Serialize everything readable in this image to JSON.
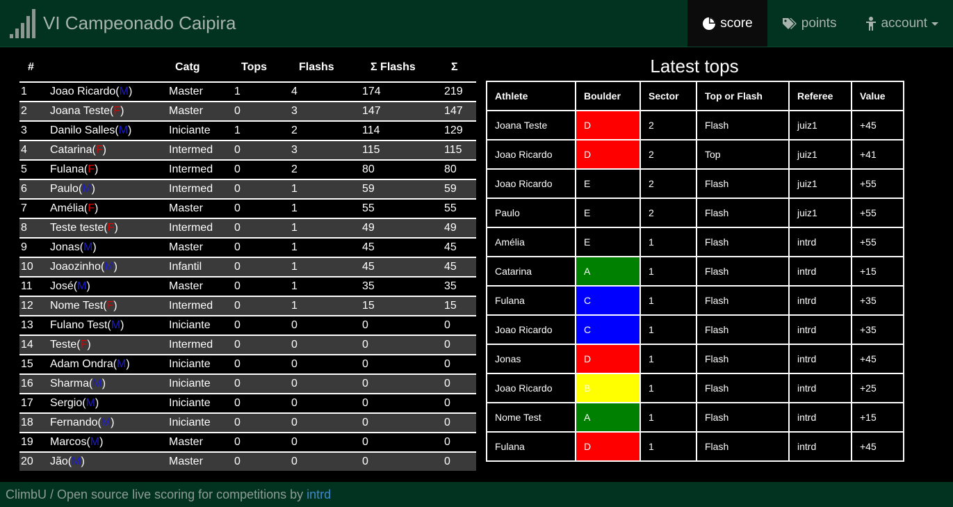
{
  "app": {
    "title": "VI Campeonado Caipira"
  },
  "nav": [
    {
      "label": "score",
      "icon": "pie-chart-icon",
      "active": true
    },
    {
      "label": "points",
      "icon": "tags-icon",
      "active": false
    },
    {
      "label": "account",
      "icon": "person-icon",
      "active": false,
      "dropdown": true
    }
  ],
  "scoreboard": {
    "headers": [
      "#",
      "",
      "Catg",
      "Tops",
      "Flashs",
      "Σ Flashs",
      "Σ"
    ],
    "rows": [
      {
        "rank": "1",
        "name": "Joao Ricardo",
        "gender": "M",
        "catg": "Master",
        "tops": "1",
        "flashs": "4",
        "sum_flashs": "174",
        "total": "219"
      },
      {
        "rank": "2",
        "name": "Joana Teste",
        "gender": "F",
        "catg": "Master",
        "tops": "0",
        "flashs": "3",
        "sum_flashs": "147",
        "total": "147"
      },
      {
        "rank": "3",
        "name": "Danilo Salles",
        "gender": "M",
        "catg": "Iniciante",
        "tops": "1",
        "flashs": "2",
        "sum_flashs": "114",
        "total": "129"
      },
      {
        "rank": "4",
        "name": "Catarina",
        "gender": "F",
        "catg": "Intermed",
        "tops": "0",
        "flashs": "3",
        "sum_flashs": "115",
        "total": "115"
      },
      {
        "rank": "5",
        "name": "Fulana",
        "gender": "F",
        "catg": "Intermed",
        "tops": "0",
        "flashs": "2",
        "sum_flashs": "80",
        "total": "80"
      },
      {
        "rank": "6",
        "name": "Paulo",
        "gender": "M",
        "catg": "Intermed",
        "tops": "0",
        "flashs": "1",
        "sum_flashs": "59",
        "total": "59"
      },
      {
        "rank": "7",
        "name": "Amélia",
        "gender": "F",
        "catg": "Master",
        "tops": "0",
        "flashs": "1",
        "sum_flashs": "55",
        "total": "55"
      },
      {
        "rank": "8",
        "name": "Teste teste",
        "gender": "F",
        "catg": "Intermed",
        "tops": "0",
        "flashs": "1",
        "sum_flashs": "49",
        "total": "49"
      },
      {
        "rank": "9",
        "name": "Jonas",
        "gender": "M",
        "catg": "Master",
        "tops": "0",
        "flashs": "1",
        "sum_flashs": "45",
        "total": "45"
      },
      {
        "rank": "10",
        "name": "Joaozinho",
        "gender": "M",
        "catg": "Infantil",
        "tops": "0",
        "flashs": "1",
        "sum_flashs": "45",
        "total": "45"
      },
      {
        "rank": "11",
        "name": "José",
        "gender": "M",
        "catg": "Master",
        "tops": "0",
        "flashs": "1",
        "sum_flashs": "35",
        "total": "35"
      },
      {
        "rank": "12",
        "name": "Nome Test",
        "gender": "F",
        "catg": "Intermed",
        "tops": "0",
        "flashs": "1",
        "sum_flashs": "15",
        "total": "15"
      },
      {
        "rank": "13",
        "name": "Fulano Test",
        "gender": "M",
        "catg": "Iniciante",
        "tops": "0",
        "flashs": "0",
        "sum_flashs": "0",
        "total": "0"
      },
      {
        "rank": "14",
        "name": "Teste",
        "gender": "F",
        "catg": "Intermed",
        "tops": "0",
        "flashs": "0",
        "sum_flashs": "0",
        "total": "0"
      },
      {
        "rank": "15",
        "name": "Adam Ondra",
        "gender": "M",
        "catg": "Iniciante",
        "tops": "0",
        "flashs": "0",
        "sum_flashs": "0",
        "total": "0"
      },
      {
        "rank": "16",
        "name": "Sharma",
        "gender": "M",
        "catg": "Iniciante",
        "tops": "0",
        "flashs": "0",
        "sum_flashs": "0",
        "total": "0"
      },
      {
        "rank": "17",
        "name": "Sergio",
        "gender": "M",
        "catg": "Iniciante",
        "tops": "0",
        "flashs": "0",
        "sum_flashs": "0",
        "total": "0"
      },
      {
        "rank": "18",
        "name": "Fernando",
        "gender": "M",
        "catg": "Iniciante",
        "tops": "0",
        "flashs": "0",
        "sum_flashs": "0",
        "total": "0"
      },
      {
        "rank": "19",
        "name": "Marcos",
        "gender": "M",
        "catg": "Master",
        "tops": "0",
        "flashs": "0",
        "sum_flashs": "0",
        "total": "0"
      },
      {
        "rank": "20",
        "name": "Jão",
        "gender": "M",
        "catg": "Master",
        "tops": "0",
        "flashs": "0",
        "sum_flashs": "0",
        "total": "0"
      }
    ]
  },
  "gender_colors": {
    "M": "#1c1cc7",
    "F": "#e00000"
  },
  "latest_tops": {
    "title": "Latest tops",
    "headers": [
      "Athlete",
      "Boulder",
      "Sector",
      "Top or Flash",
      "Referee",
      "Value"
    ],
    "rows": [
      {
        "athlete": "Joana Teste",
        "boulder": "D",
        "boulder_color": "#ff0000",
        "boulder_text_color": "#ffffff",
        "sector": "2",
        "type": "Flash",
        "referee": "juiz1",
        "value": "+45"
      },
      {
        "athlete": "Joao Ricardo",
        "boulder": "D",
        "boulder_color": "#ff0000",
        "boulder_text_color": "#ffffff",
        "sector": "2",
        "type": "Top",
        "referee": "juiz1",
        "value": "+41"
      },
      {
        "athlete": "Joao Ricardo",
        "boulder": "E",
        "boulder_color": "#000000",
        "boulder_text_color": "#ffffff",
        "sector": "2",
        "type": "Flash",
        "referee": "juiz1",
        "value": "+55"
      },
      {
        "athlete": "Paulo",
        "boulder": "E",
        "boulder_color": "#000000",
        "boulder_text_color": "#ffffff",
        "sector": "2",
        "type": "Flash",
        "referee": "juiz1",
        "value": "+55"
      },
      {
        "athlete": "Amélia",
        "boulder": "E",
        "boulder_color": "#000000",
        "boulder_text_color": "#ffffff",
        "sector": "1",
        "type": "Flash",
        "referee": "intrd",
        "value": "+55"
      },
      {
        "athlete": "Catarina",
        "boulder": "A",
        "boulder_color": "#008000",
        "boulder_text_color": "#ffffff",
        "sector": "1",
        "type": "Flash",
        "referee": "intrd",
        "value": "+15"
      },
      {
        "athlete": "Fulana",
        "boulder": "C",
        "boulder_color": "#0000ff",
        "boulder_text_color": "#ffffff",
        "sector": "1",
        "type": "Flash",
        "referee": "intrd",
        "value": "+35"
      },
      {
        "athlete": "Joao Ricardo",
        "boulder": "C",
        "boulder_color": "#0000ff",
        "boulder_text_color": "#ffffff",
        "sector": "1",
        "type": "Flash",
        "referee": "intrd",
        "value": "+35"
      },
      {
        "athlete": "Jonas",
        "boulder": "D",
        "boulder_color": "#ff0000",
        "boulder_text_color": "#ffffff",
        "sector": "1",
        "type": "Flash",
        "referee": "intrd",
        "value": "+45"
      },
      {
        "athlete": "Joao Ricardo",
        "boulder": "B",
        "boulder_color": "#ffff00",
        "boulder_text_color": "#ffffff",
        "sector": "1",
        "type": "Flash",
        "referee": "intrd",
        "value": "+25"
      },
      {
        "athlete": "Nome Test",
        "boulder": "A",
        "boulder_color": "#008000",
        "boulder_text_color": "#ffffff",
        "sector": "1",
        "type": "Flash",
        "referee": "intrd",
        "value": "+15"
      },
      {
        "athlete": "Fulana",
        "boulder": "D",
        "boulder_color": "#ff0000",
        "boulder_text_color": "#ffffff",
        "sector": "1",
        "type": "Flash",
        "referee": "intrd",
        "value": "+45"
      }
    ]
  },
  "footer": {
    "text": "ClimbU / Open source live scoring for competitions by ",
    "link": "intrd"
  }
}
